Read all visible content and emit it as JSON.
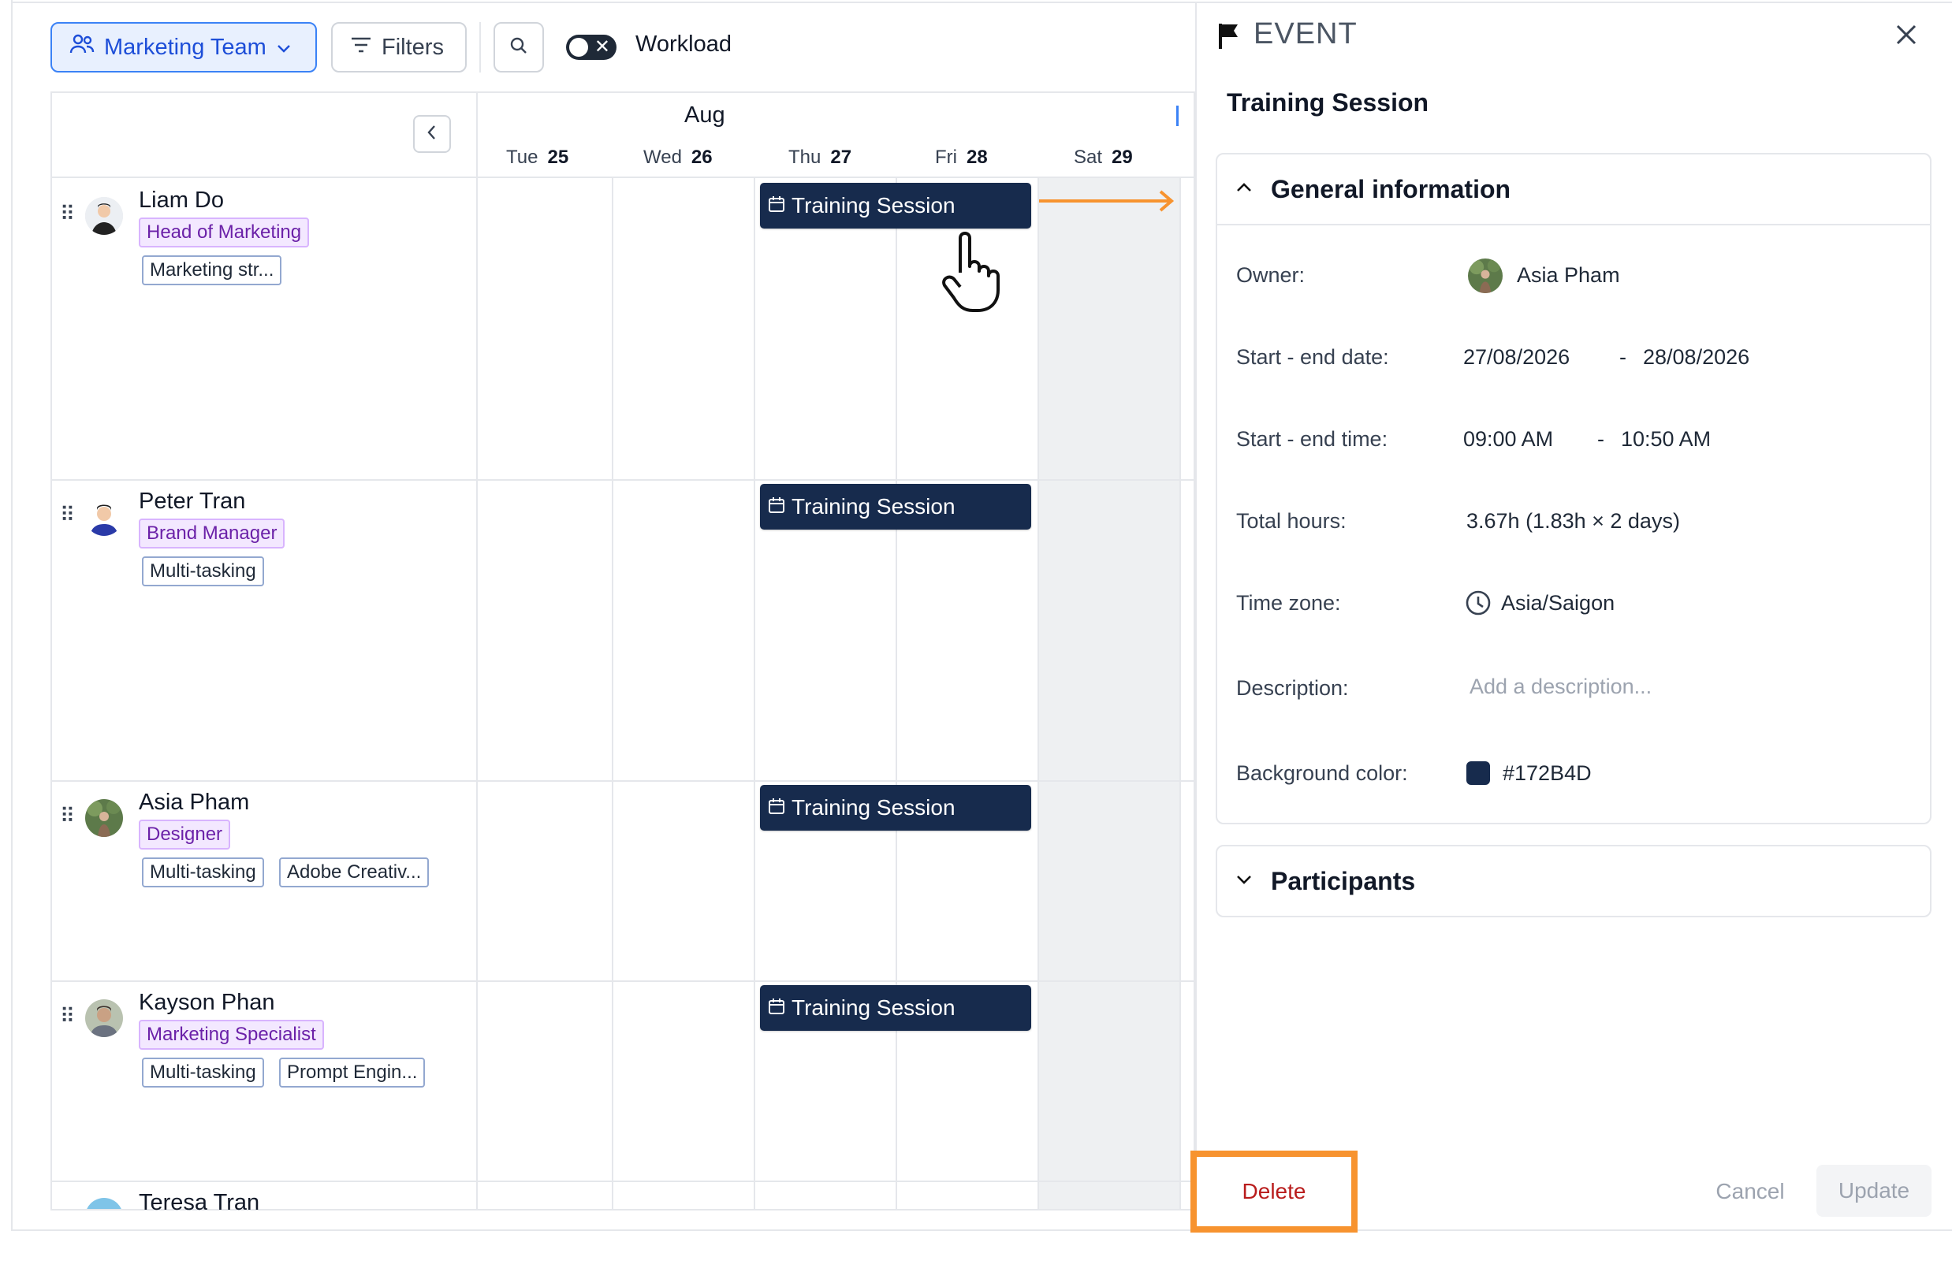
{
  "toolbar": {
    "team_label": "Marketing Team",
    "filters_label": "Filters",
    "workload_label": "Workload"
  },
  "calendar": {
    "month": "Aug",
    "days": [
      {
        "dow": "Tue",
        "num": "25"
      },
      {
        "dow": "Wed",
        "num": "26"
      },
      {
        "dow": "Thu",
        "num": "27"
      },
      {
        "dow": "Fri",
        "num": "28"
      },
      {
        "dow": "Sat",
        "num": "29"
      }
    ],
    "people": [
      {
        "name": "Liam Do",
        "role": "Head of Marketing",
        "skills": [
          "Marketing str..."
        ],
        "event": "Training Session"
      },
      {
        "name": "Peter Tran",
        "role": "Brand Manager",
        "skills": [
          "Multi-tasking"
        ],
        "event": "Training Session"
      },
      {
        "name": "Asia Pham",
        "role": "Designer",
        "skills": [
          "Multi-tasking",
          "Adobe Creativ..."
        ],
        "event": "Training Session"
      },
      {
        "name": "Kayson Phan",
        "role": "Marketing Specialist",
        "skills": [
          "Multi-tasking",
          "Prompt Engin..."
        ],
        "event": "Training Session"
      },
      {
        "name": "Teresa Tran"
      }
    ]
  },
  "panel": {
    "kind": "EVENT",
    "title": "Training Session",
    "general_section": "General information",
    "fields": {
      "owner_label": "Owner:",
      "owner_value": "Asia Pham",
      "dates_label": "Start - end date:",
      "start_date": "27/08/2026",
      "end_date": "28/08/2026",
      "times_label": "Start - end time:",
      "start_time": "09:00 AM",
      "end_time": "10:50 AM",
      "hours_label": "Total hours:",
      "hours_value": "3.67h (1.83h × 2 days)",
      "tz_label": "Time zone:",
      "tz_value": "Asia/Saigon",
      "desc_label": "Description:",
      "desc_placeholder": "Add a description...",
      "bg_label": "Background color:",
      "bg_value": "#172B4D"
    },
    "dash": "-",
    "participants_section": "Participants",
    "delete_label": "Delete",
    "cancel_label": "Cancel",
    "update_label": "Update"
  },
  "colors": {
    "event_bg": "#172B4D",
    "accent_blue": "#1d4ed8",
    "highlight_orange": "#F7932F"
  }
}
